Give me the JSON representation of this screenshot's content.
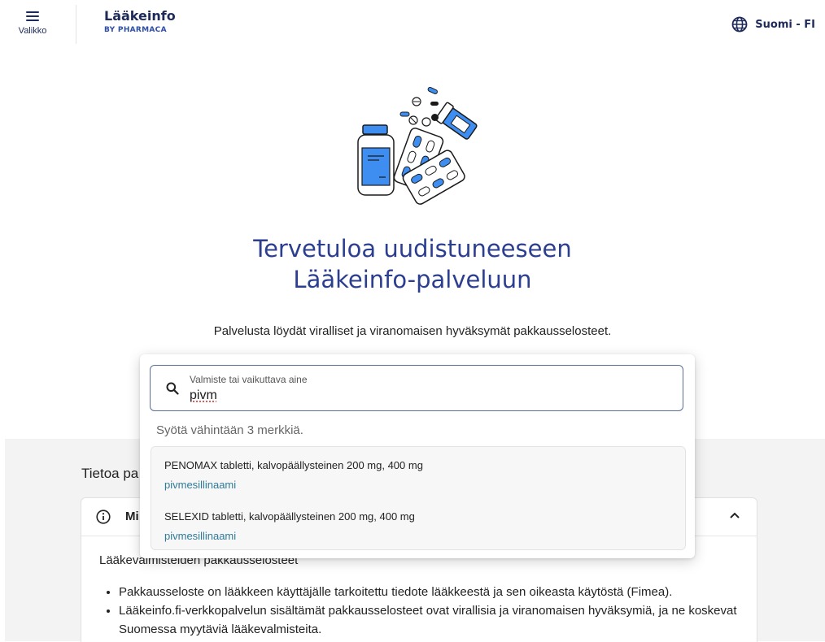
{
  "header": {
    "menu_label": "Valikko",
    "logo_title": "Lääkeinfo",
    "logo_subtitle": "BY PHARMACA",
    "language_label": "Suomi - FI"
  },
  "hero": {
    "title_line1": "Tervetuloa uudistuneeseen",
    "title_line2": "Lääkeinfo-palveluun",
    "subtitle": "Palvelusta löydät viralliset ja viranomaisen hyväksymät pakkausselosteet."
  },
  "search": {
    "label": "Valmiste tai vaikuttava aine",
    "value": "pivm",
    "hint": "Syötä vähintään 3 merkkiä.",
    "results": [
      {
        "name": "PENOMAX tabletti, kalvopäällysteinen 200 mg, 400 mg",
        "substance": "pivmesillinaami"
      },
      {
        "name": "SELEXID tabletti, kalvopäällysteinen 200 mg, 400 mg",
        "substance": "pivmesillinaami"
      }
    ]
  },
  "about": {
    "heading": "Tietoa pa",
    "accordion_title": "Mi",
    "body_heading": "Lääkevalmisteiden pakkausselosteet",
    "bullets": [
      "Pakkausseloste on lääkkeen käyttäjälle tarkoitettu tiedote lääkkeestä ja sen oikeasta käytöstä (Fimea).",
      "Lääkeinfo.fi-verkkopalvelun sisältämät pakkausselosteet ovat virallisia ja viranomaisen hyväksymiä, ja ne koskevat Suomessa myytäviä lääkevalmisteita."
    ]
  },
  "colors": {
    "brand_navy": "#1e2b5a",
    "title_blue": "#2c3e8f",
    "link_teal": "#2f7a99",
    "illustration_blue": "#3d8ef0"
  },
  "icons": {
    "menu": "hamburger-icon",
    "language": "globe-icon",
    "search": "search-icon",
    "info": "info-icon",
    "collapse": "chevron-up-icon"
  }
}
